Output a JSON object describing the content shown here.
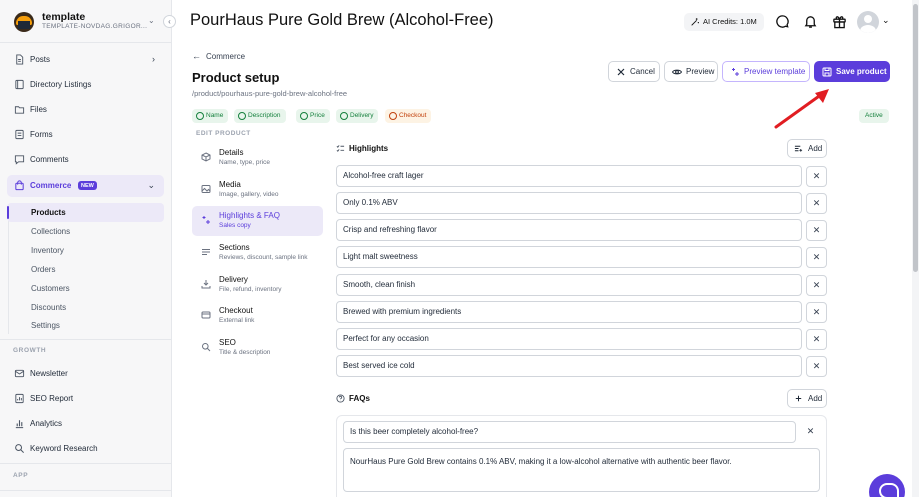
{
  "app": {
    "workspace_name": "template",
    "workspace_sub": "TEMPLATE-NOVDAG.GRIGOR...",
    "credits": "AI Credits: 1.0M",
    "page_title": "PourHaus Pure Gold Brew (Alcohol-Free)"
  },
  "sidebar": {
    "items": [
      {
        "label": "Posts",
        "icon": "file-icon",
        "has_chevron": true
      },
      {
        "label": "Directory Listings",
        "icon": "book-icon"
      },
      {
        "label": "Files",
        "icon": "folder-icon"
      },
      {
        "label": "Forms",
        "icon": "form-icon"
      },
      {
        "label": "Comments",
        "icon": "comment-icon"
      },
      {
        "label": "Commerce",
        "icon": "shopping-bag-icon",
        "badge": "NEW",
        "expanded": true
      }
    ],
    "commerce_sub": [
      "Products",
      "Collections",
      "Inventory",
      "Orders",
      "Customers",
      "Discounts",
      "Settings"
    ],
    "growth_label": "GROWTH",
    "growth_items": [
      {
        "label": "Newsletter",
        "icon": "mail-icon"
      },
      {
        "label": "SEO Report",
        "icon": "seo-icon"
      },
      {
        "label": "Analytics",
        "icon": "bar-chart-icon"
      },
      {
        "label": "Keyword Research",
        "icon": "search-icon"
      }
    ],
    "app_label": "APP"
  },
  "product": {
    "back_label": "Commerce",
    "title": "Product setup",
    "path": "/product/pourhaus-pure-gold-brew-alcohol-free",
    "buttons": {
      "cancel": "Cancel",
      "preview": "Preview",
      "preview_template": "Preview template",
      "save": "Save product"
    },
    "chips": [
      {
        "label": "Name",
        "state": "ok"
      },
      {
        "label": "Description",
        "state": "ok"
      },
      {
        "label": "Price",
        "state": "ok"
      },
      {
        "label": "Delivery",
        "state": "ok"
      },
      {
        "label": "Checkout",
        "state": "warn"
      }
    ],
    "status": "Active",
    "edit_label": "EDIT PRODUCT",
    "steps": [
      {
        "title": "Details",
        "sub": "Name, type, price",
        "icon": "box-icon"
      },
      {
        "title": "Media",
        "sub": "Image, gallery, video",
        "icon": "image-icon"
      },
      {
        "title": "Highlights & FAQ",
        "sub": "Sales copy",
        "icon": "sparkle-icon",
        "active": true
      },
      {
        "title": "Sections",
        "sub": "Reviews, discount, sample link",
        "icon": "list-icon"
      },
      {
        "title": "Delivery",
        "sub": "File, refund, inventory",
        "icon": "download-icon"
      },
      {
        "title": "Checkout",
        "sub": "External link",
        "icon": "card-icon"
      },
      {
        "title": "SEO",
        "sub": "Title & description",
        "icon": "search-icon"
      }
    ],
    "highlights_label": "Highlights",
    "add_label": "Add",
    "highlights": [
      "Alcohol-free craft lager",
      "Only 0.1% ABV",
      "Crisp and refreshing flavor",
      "Light malt sweetness",
      "Smooth, clean finish",
      "Brewed with premium ingredients",
      "Perfect for any occasion",
      "Best served ice cold"
    ],
    "faqs_label": "FAQs",
    "faqs": [
      {
        "question": "Is this beer completely alcohol-free?",
        "answer": "NourHaus Pure Gold Brew contains 0.1% ABV, making it a low-alcohol alternative with authentic beer flavor."
      }
    ]
  },
  "colors": {
    "accent": "#5b3ddb",
    "success": "#15803d",
    "warning": "#c2410c",
    "annotation_arrow": "#e11d22"
  }
}
